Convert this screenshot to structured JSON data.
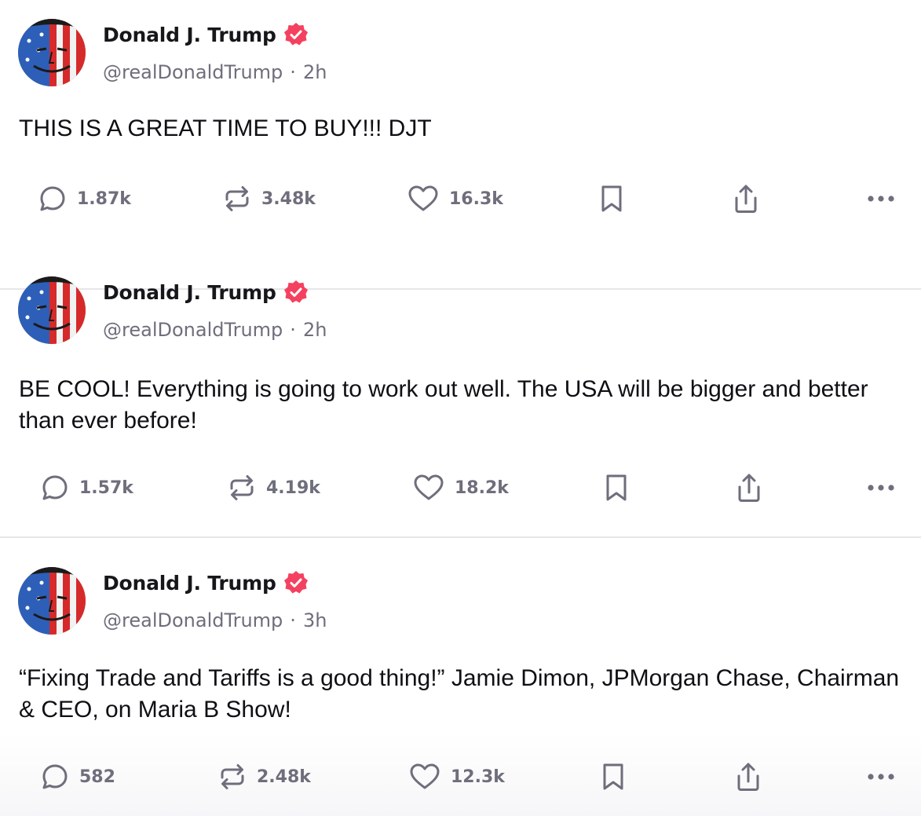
{
  "colors": {
    "verified_badge": "#f4415f",
    "icon_gray": "#6e6e7c",
    "divider": "#e6e6ea"
  },
  "posts": [
    {
      "display_name": "Donald J. Trump",
      "handle": "@realDonaldTrump",
      "separator": "·",
      "time": "2h",
      "text": "THIS IS A GREAT TIME TO BUY!!! DJT",
      "replies": "1.87k",
      "reposts": "3.48k",
      "likes": "16.3k"
    },
    {
      "display_name": "Donald J. Trump",
      "handle": "@realDonaldTrump",
      "separator": "·",
      "time": "2h",
      "text": "BE COOL! Everything is going to work out well. The USA will be bigger and better than ever before!",
      "replies": "1.57k",
      "reposts": "4.19k",
      "likes": "18.2k"
    },
    {
      "display_name": "Donald J. Trump",
      "handle": "@realDonaldTrump",
      "separator": "·",
      "time": "3h",
      "text": "“Fixing Trade and Tariffs is a good thing!” Jamie Dimon, JPMorgan Chase, Chairman & CEO, on Maria B Show!",
      "replies": "582",
      "reposts": "2.48k",
      "likes": "12.3k"
    }
  ]
}
